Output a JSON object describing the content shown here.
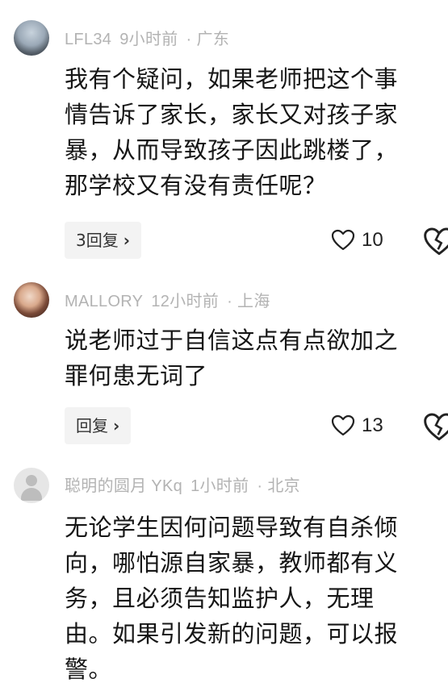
{
  "comments": [
    {
      "username": "LFL34",
      "time": "9小时前",
      "separator": "·",
      "location": "广东",
      "lines": [
        "我有个疑问，如果老师把这个事",
        "情告诉了家长，家长又对孩子家",
        "暴，从而导致孩子因此跳楼了，",
        "那学校又有没有责任呢？"
      ],
      "reply_label": "3回复",
      "like_count": "10"
    },
    {
      "username": "MALLORY",
      "time": "12小时前",
      "separator": "·",
      "location": "上海",
      "lines": [
        "说老师过于自信这点有点欲加之",
        "罪何患无词了"
      ],
      "reply_label": "回复",
      "like_count": "13"
    },
    {
      "username": "聪明的圆月 YKq",
      "time": "1小时前",
      "separator": "·",
      "location": "北京",
      "lines": [
        "无论学生因何问题导致有自杀倾",
        "向，哪怕源自家暴，教师都有义",
        "务，且必须告知监护人，无理",
        "由。如果引发新的问题，可以报",
        "警。"
      ]
    }
  ],
  "icons": {
    "reply_chevron": "chevron-right-icon",
    "like": "heart-icon",
    "dislike": "broken-heart-icon"
  }
}
